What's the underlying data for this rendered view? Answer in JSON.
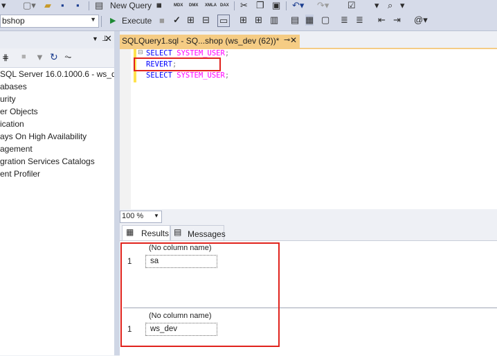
{
  "toolbar": {
    "new_query_label": "New Query",
    "file_icons": [
      "MDX",
      "DMX",
      "XMLA",
      "DAX"
    ],
    "database": "bshop",
    "execute_label": "Execute"
  },
  "object_explorer": {
    "items": [
      "SQL Server 16.0.1000.6 - ws_dev",
      "abases",
      "urity",
      "er Objects",
      "ication",
      "ays On High Availability",
      "agement",
      "gration Services Catalogs",
      "ent Profiler"
    ]
  },
  "editor": {
    "tab_title": "SQLQuery1.sql - SQ...shop (ws_dev (62))*",
    "lines": [
      {
        "kw": "SELECT",
        "fn": "SYSTEM_USER",
        "end": ";"
      },
      {
        "kw": "REVERT",
        "fn": "",
        "end": ";"
      },
      {
        "kw": "SELECT",
        "fn": "SYSTEM_USER",
        "end": ";"
      }
    ],
    "zoom": "100 %"
  },
  "results": {
    "tabs": [
      "Results",
      "Messages"
    ],
    "grids": [
      {
        "header": "(No column name)",
        "row": "1",
        "value": "sa"
      },
      {
        "header": "(No column name)",
        "row": "1",
        "value": "ws_dev"
      }
    ]
  },
  "colors": {
    "highlight_red": "#e0221c",
    "tab_active": "#f5cc84"
  }
}
